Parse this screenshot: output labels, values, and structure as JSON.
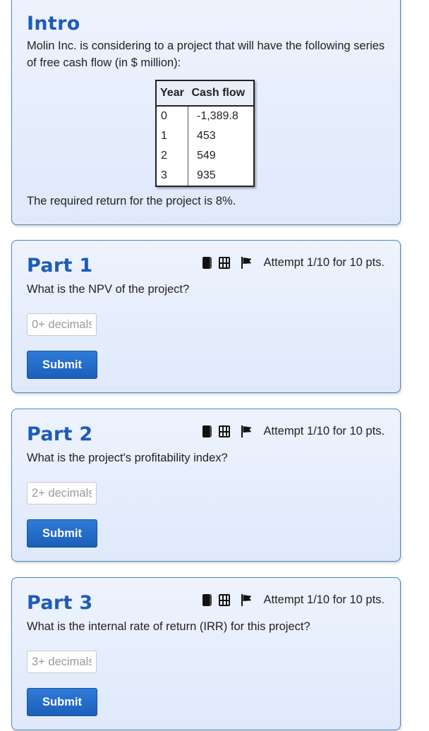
{
  "intro": {
    "title": "Intro",
    "description": "Molin Inc. is considering to a project that will have the following series of free cash flow (in $ million):",
    "table": {
      "headers": [
        "Year",
        "Cash flow"
      ],
      "rows": [
        [
          "0",
          "-1,389.8"
        ],
        [
          "1",
          "453"
        ],
        [
          "2",
          "549"
        ],
        [
          "3",
          "935"
        ]
      ]
    },
    "required_return": "The required return for the project is 8%."
  },
  "parts": [
    {
      "title": "Part 1",
      "attempt": "Attempt 1/10 for 10 pts.",
      "question": "What is the NPV of the project?",
      "placeholder": "0+ decimals",
      "value": "",
      "submit": "Submit"
    },
    {
      "title": "Part 2",
      "attempt": "Attempt 1/10 for 10 pts.",
      "question": "What is the project's profitability index?",
      "placeholder": "2+ decimals",
      "value": "",
      "submit": "Submit"
    },
    {
      "title": "Part 3",
      "attempt": "Attempt 1/10 for 10 pts.",
      "question": "What is the internal rate of return (IRR) for this project?",
      "placeholder": "3+ decimals",
      "value": "",
      "submit": "Submit"
    }
  ],
  "icons": [
    "book-icon",
    "film-icon",
    "flag-icon"
  ],
  "colors": {
    "title": "#1e5bb8",
    "card_border": "#4a86c5",
    "button": "#1c5fba"
  }
}
